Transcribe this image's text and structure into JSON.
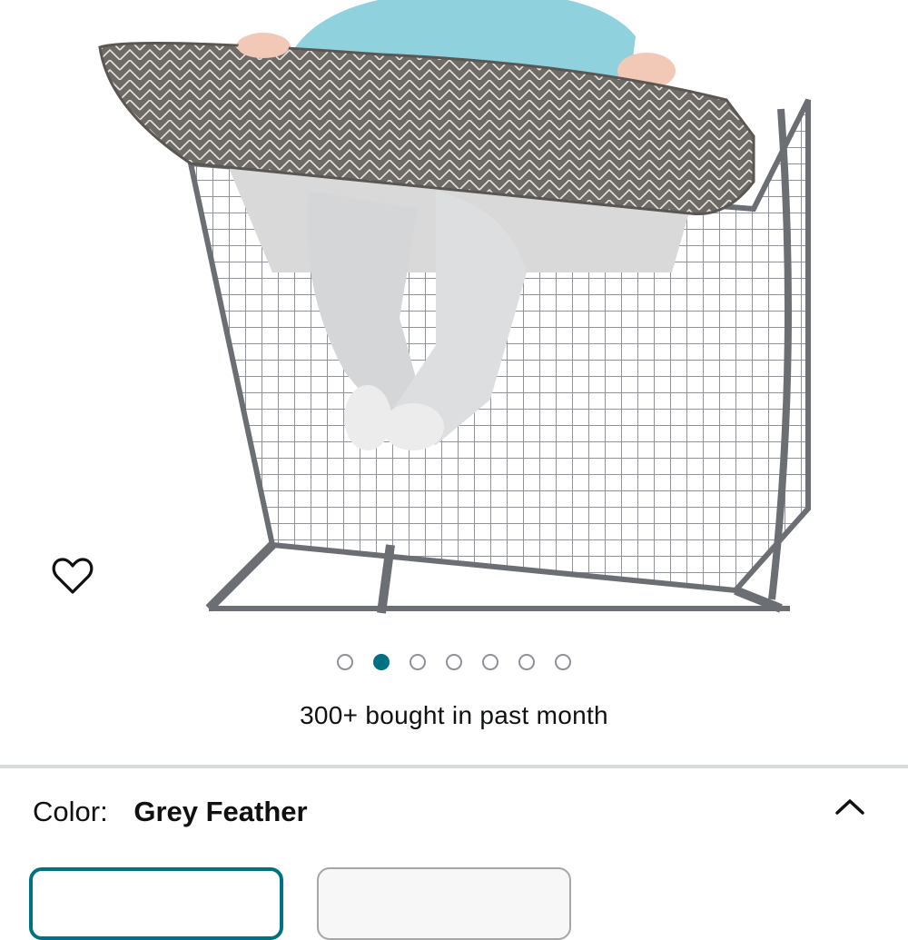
{
  "gallery": {
    "image_alt": "Baby sitting in a shopping cart with a grey feather patterned cart cover",
    "wishlist_icon": "heart-outline-icon",
    "dot_count": 7,
    "active_dot": 2
  },
  "social_proof": {
    "text": "300+ bought in past month"
  },
  "variation": {
    "label": "Color:",
    "selected_value": "Grey Feather",
    "toggle_icon": "chevron-up-icon"
  },
  "colors": {
    "accent": "#007185",
    "text": "#0f1111",
    "border": "#d5d9d9"
  }
}
